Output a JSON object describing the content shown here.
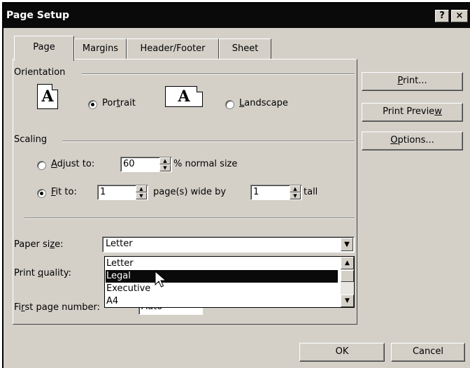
{
  "window": {
    "title": "Page Setup",
    "help_label": "?",
    "close_label": "×"
  },
  "tabs": [
    {
      "label": "Page",
      "active": true
    },
    {
      "label": "Margins",
      "active": false
    },
    {
      "label": "Header/Footer",
      "active": false
    },
    {
      "label": "Sheet",
      "active": false
    }
  ],
  "orientation": {
    "group_label": "Orientation",
    "icon_glyph": "A",
    "portrait": {
      "pre": "Por",
      "key": "t",
      "post": "rait",
      "checked": true
    },
    "landscape": {
      "pre": "",
      "key": "L",
      "post": "andscape",
      "checked": false
    }
  },
  "scaling": {
    "group_label": "Scaling",
    "adjust": {
      "pre": "",
      "key": "A",
      "post": "djust to:",
      "value": "60",
      "suffix": "% normal size",
      "checked": false
    },
    "fit": {
      "pre": "",
      "key": "F",
      "post": "it to:",
      "wide_value": "1",
      "wide_suffix": "page(s) wide by",
      "tall_value": "1",
      "tall_suffix": "tall",
      "checked": true
    }
  },
  "paper_size": {
    "label_pre": "Paper si",
    "label_key": "z",
    "label_post": "e:",
    "value": "Letter",
    "options": [
      "Letter",
      "Legal",
      "Executive",
      "A4"
    ],
    "highlighted": "Legal"
  },
  "print_quality": {
    "label_pre": "Print ",
    "label_key": "q",
    "label_post": "uality:"
  },
  "first_page_number": {
    "label_pre": "Fi",
    "label_key": "r",
    "label_post": "st page number:",
    "value": "Auto"
  },
  "side_buttons": {
    "print": {
      "pre": "",
      "key": "P",
      "post": "rint..."
    },
    "print_preview": {
      "pre": "Print Previe",
      "key": "w",
      "post": ""
    },
    "options": {
      "pre": "",
      "key": "O",
      "post": "ptions..."
    }
  },
  "footer": {
    "ok": "OK",
    "cancel": "Cancel"
  }
}
